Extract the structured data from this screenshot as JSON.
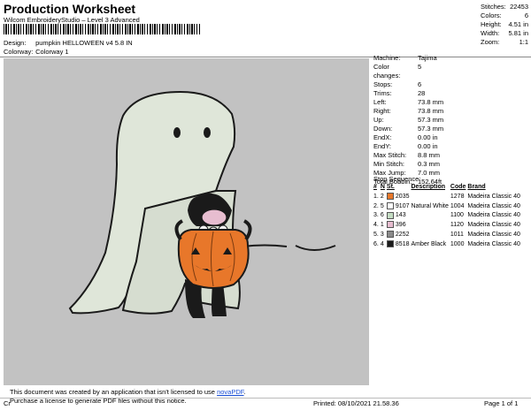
{
  "header": {
    "title": "Production Worksheet",
    "software": "Wilcom EmbroideryStudio – Level 3 Advanced",
    "design_label": "Design:",
    "design_value": "pumpkin HELLOWEEN v4 5.8 IN",
    "colorway_label": "Colorway:",
    "colorway_value": "Colorway 1"
  },
  "top_stats": [
    {
      "label": "Stitches:",
      "value": "22453"
    },
    {
      "label": "Colors:",
      "value": "6"
    },
    {
      "label": "Height:",
      "value": "4.51 in"
    },
    {
      "label": "Width:",
      "value": "5.81 in"
    },
    {
      "label": "Zoom:",
      "value": "1:1"
    }
  ],
  "machine_info": [
    {
      "label": "Machine:",
      "value": "Tajima"
    },
    {
      "label": "Color changes:",
      "value": "5"
    },
    {
      "label": "Stops:",
      "value": "6"
    },
    {
      "label": "Trims:",
      "value": "28"
    },
    {
      "label": "Left:",
      "value": "73.8 mm"
    },
    {
      "label": "Right:",
      "value": "73.8 mm"
    },
    {
      "label": "Up:",
      "value": "57.3 mm"
    },
    {
      "label": "Down:",
      "value": "57.3 mm"
    },
    {
      "label": "EndX:",
      "value": "0.00 in"
    },
    {
      "label": "EndY:",
      "value": "0.00 in"
    },
    {
      "label": "Max Stitch:",
      "value": "8.8 mm"
    },
    {
      "label": "Min Stitch:",
      "value": "0.3 mm"
    },
    {
      "label": "Max Jump:",
      "value": "7.0 mm"
    },
    {
      "label": "Total Bobbin:",
      "value": "152.64ft"
    }
  ],
  "stop_sequence": {
    "title": "Stop Sequence:",
    "columns": [
      "#",
      "N",
      "St.",
      "Description",
      "Code",
      "Brand"
    ],
    "rows": [
      {
        "num": "1.",
        "n": "2",
        "swatch": "#e8772a",
        "st": "2035",
        "desc": "",
        "code": "1278",
        "brand": "Madeira Classic 40"
      },
      {
        "num": "2.",
        "n": "5",
        "swatch": "#ffffff",
        "st": "9107",
        "desc": "Natural White",
        "code": "1004",
        "brand": "Madeira Classic 40"
      },
      {
        "num": "3.",
        "n": "6",
        "swatch": "#c4dcc3",
        "st": "143",
        "desc": "",
        "code": "1100",
        "brand": "Madeira Classic 40"
      },
      {
        "num": "4.",
        "n": "1",
        "swatch": "#e7bdd0",
        "st": "396",
        "desc": "",
        "code": "1120",
        "brand": "Madeira Classic 40"
      },
      {
        "num": "5.",
        "n": "3",
        "swatch": "#8a8a8a",
        "st": "2252",
        "desc": "",
        "code": "1011",
        "brand": "Madeira Classic 40"
      },
      {
        "num": "6.",
        "n": "4",
        "swatch": "#1a1a1a",
        "st": "8518",
        "desc": "Amber Black",
        "code": "1000",
        "brand": "Madeira Classic 40"
      }
    ]
  },
  "notice": {
    "line1": "This document was created by an application that isn't licensed to use ",
    "link": "novaPDF",
    "line1_end": ".",
    "line2": "Purchase a license to generate PDF files without this notice."
  },
  "footer": {
    "left": "Cr",
    "printed": "Printed: 08/10/2021 21.58.36",
    "page": "Page 1 of 1"
  },
  "colors": {
    "canvas_bg": "#c2c2c2",
    "ghost": "#dfe6d9",
    "pumpkin": "#e8772a",
    "link": "#1a4fd6"
  }
}
